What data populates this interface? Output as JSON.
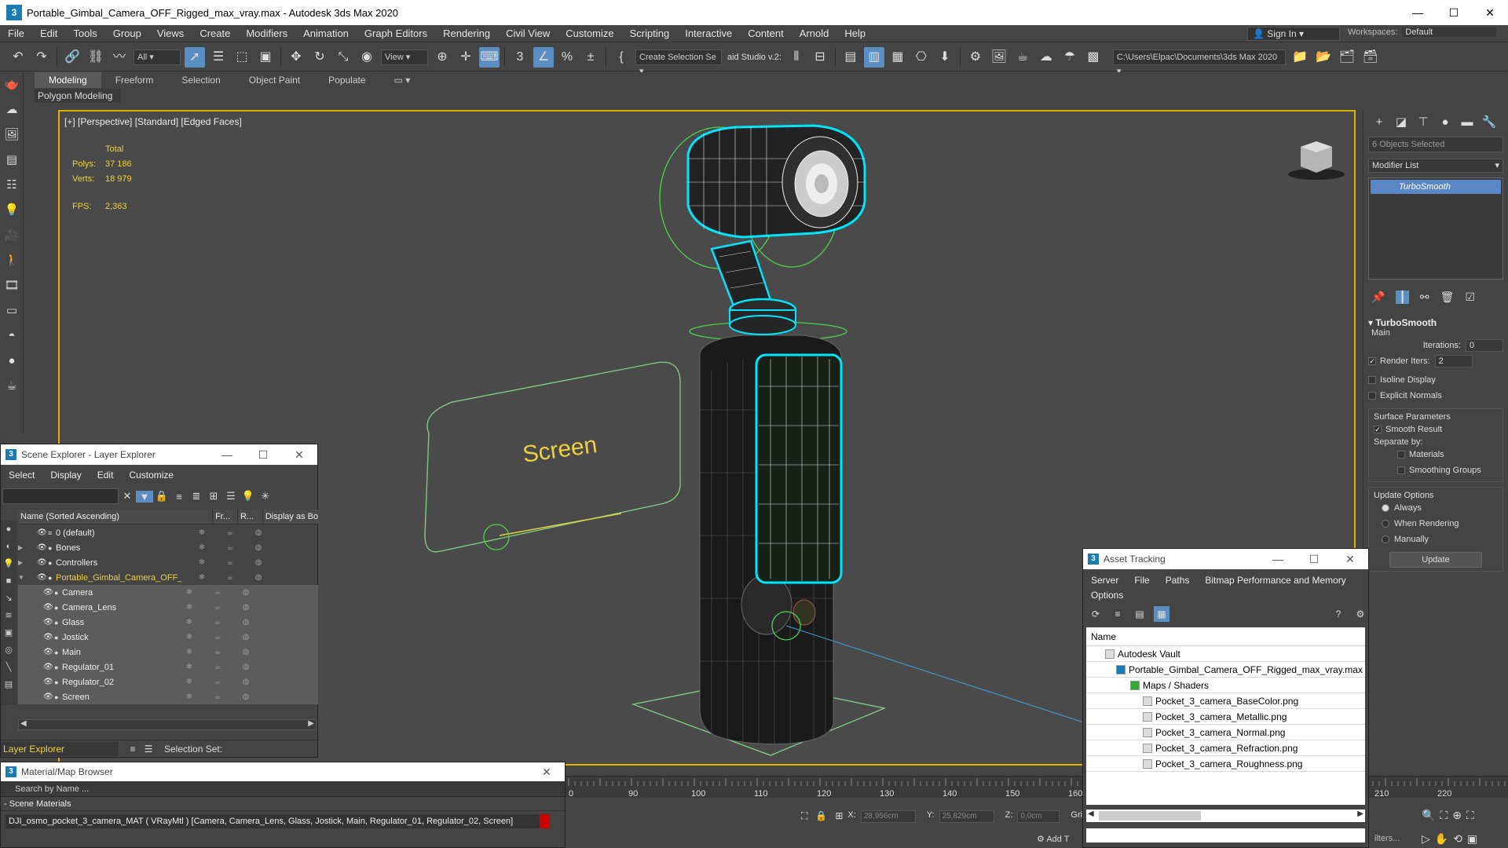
{
  "window": {
    "title": "Portable_Gimbal_Camera_OFF_Rigged_max_vray.max - Autodesk 3ds Max 2020",
    "logo": "3"
  },
  "menu": [
    "File",
    "Edit",
    "Tools",
    "Group",
    "Views",
    "Create",
    "Modifiers",
    "Animation",
    "Graph Editors",
    "Rendering",
    "Civil View",
    "Customize",
    "Scripting",
    "Interactive",
    "Content",
    "Arnold",
    "Help"
  ],
  "account": {
    "signin": "Sign In",
    "workspaces_label": "Workspaces:",
    "workspace": "Default"
  },
  "toolbar": {
    "filter": "All",
    "refcoord": "View",
    "selection_set": "Create Selection Se",
    "studio": "aid Studio v.2:",
    "project_path": "C:\\Users\\Elpac\\Documents\\3ds Max 2020"
  },
  "ribbon": {
    "tabs": [
      "Modeling",
      "Freeform",
      "Selection",
      "Object Paint",
      "Populate"
    ],
    "panel": "Polygon Modeling"
  },
  "viewport": {
    "label": "[+] [Perspective] [Standard] [Edged Faces]",
    "stats_header": "Total",
    "polys_label": "Polys:",
    "polys": "37 186",
    "verts_label": "Verts:",
    "verts": "18 979",
    "fps_label": "FPS:",
    "fps": "2,363",
    "screen_text": "Screen"
  },
  "command_panel": {
    "objects_selected": "6 Objects Selected",
    "modifier_list": "Modifier List",
    "stack_item": "TurboSmooth",
    "rollout_title": "TurboSmooth",
    "main_label": "Main",
    "iterations_label": "Iterations:",
    "iterations": "0",
    "render_iters_label": "Render Iters:",
    "render_iters": "2",
    "isoline": "Isoline Display",
    "explicit_normals": "Explicit Normals",
    "surface_params": "Surface Parameters",
    "smooth_result": "Smooth Result",
    "separate_by": "Separate by:",
    "materials": "Materials",
    "smoothing_groups": "Smoothing Groups",
    "update_options": "Update Options",
    "always": "Always",
    "when_rendering": "When Rendering",
    "manually": "Manually",
    "update_button": "Update"
  },
  "scene_explorer": {
    "title": "Scene Explorer - Layer Explorer",
    "menu": [
      "Select",
      "Display",
      "Edit",
      "Customize"
    ],
    "columns": [
      "Name (Sorted Ascending)",
      "Fr...",
      "R...",
      "Display as Bo"
    ],
    "rows": [
      {
        "name": "0 (default)",
        "level": 0,
        "expand": ""
      },
      {
        "name": "Bones",
        "level": 0,
        "expand": "▶"
      },
      {
        "name": "Controllers",
        "level": 0,
        "expand": "▶"
      },
      {
        "name": "Portable_Gimbal_Camera_OFF_Rigged",
        "level": 0,
        "expand": "▼"
      },
      {
        "name": "Camera",
        "level": 1,
        "expand": ""
      },
      {
        "name": "Camera_Lens",
        "level": 1,
        "expand": ""
      },
      {
        "name": "Glass",
        "level": 1,
        "expand": ""
      },
      {
        "name": "Jostick",
        "level": 1,
        "expand": ""
      },
      {
        "name": "Main",
        "level": 1,
        "expand": ""
      },
      {
        "name": "Regulator_01",
        "level": 1,
        "expand": ""
      },
      {
        "name": "Regulator_02",
        "level": 1,
        "expand": ""
      },
      {
        "name": "Screen",
        "level": 1,
        "expand": ""
      }
    ],
    "layer_explorer": "Layer Explorer",
    "selection_set": "Selection Set:"
  },
  "material_browser": {
    "title": "Material/Map Browser",
    "search": "Search by Name ...",
    "section": "Scene Materials",
    "item": "DJI_osmo_pocket_3_camera_MAT  ( VRayMtl )  [Camera, Camera_Lens, Glass, Jostick, Main, Regulator_01, Regulator_02, Screen]"
  },
  "asset_tracking": {
    "title": "Asset Tracking",
    "menu": [
      "Server",
      "File",
      "Paths",
      "Bitmap Performance and Memory"
    ],
    "menu2": "Options",
    "column": "Name",
    "rows": [
      {
        "name": "Autodesk Vault",
        "indent": 1
      },
      {
        "name": "Portable_Gimbal_Camera_OFF_Rigged_max_vray.max",
        "indent": 2
      },
      {
        "name": "Maps / Shaders",
        "indent": 3
      },
      {
        "name": "Pocket_3_camera_BaseColor.png",
        "indent": 4
      },
      {
        "name": "Pocket_3_camera_Metallic.png",
        "indent": 4
      },
      {
        "name": "Pocket_3_camera_Normal.png",
        "indent": 4
      },
      {
        "name": "Pocket_3_camera_Refraction.png",
        "indent": 4
      },
      {
        "name": "Pocket_3_camera_Roughness.png",
        "indent": 4
      }
    ]
  },
  "timeline": {
    "ticks": [
      "0",
      "90",
      "100",
      "110",
      "120",
      "130",
      "140",
      "150",
      "160",
      "210",
      "220"
    ]
  },
  "status": {
    "x_label": "X:",
    "x": "28,956cm",
    "y_label": "Y:",
    "y": "25,829cm",
    "z_label": "Z:",
    "z": "0,0cm",
    "grid": "Grid =",
    "add_t": "Add T",
    "filters": "ilters..."
  },
  "colors": {
    "accent": "#5b8ec2",
    "viewport_border": "#e0b100",
    "stats": "#f0d040",
    "selection": "#00e5ff"
  }
}
